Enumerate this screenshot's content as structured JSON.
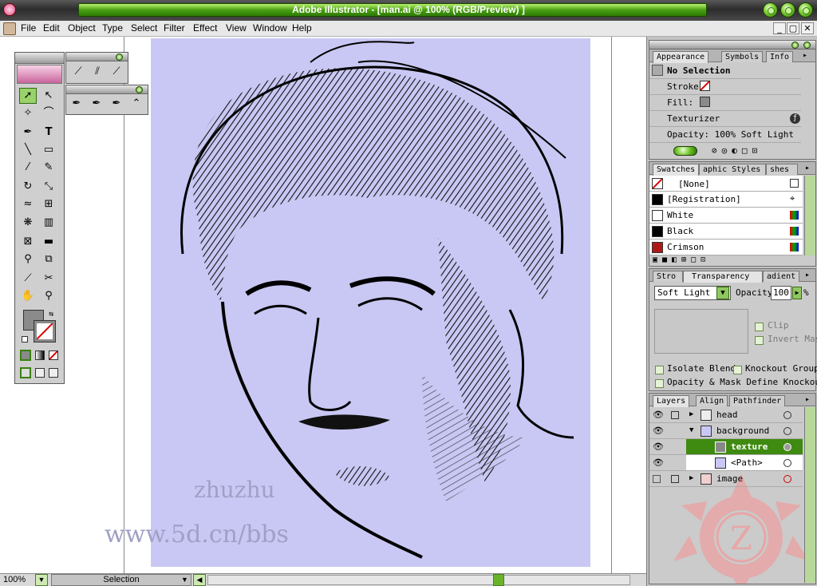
{
  "window": {
    "title": "Adobe Illustrator - [man.ai @ 100% (RGB/Preview) ]"
  },
  "menu": [
    "File",
    "Edit",
    "Object",
    "Type",
    "Select",
    "Filter",
    "Effect",
    "View",
    "Window",
    "Help"
  ],
  "window_controls": {
    "minimize": "_",
    "restore": "▢",
    "close": "✕"
  },
  "canvas": {
    "watermark_name": "zhuzhu",
    "watermark_url": "www.5d.cn/bbs"
  },
  "appearance": {
    "tabs": [
      "Appearance",
      "Symbols",
      "Info"
    ],
    "heading": "No Selection",
    "stroke_label": "Stroke:",
    "fill_label": "Fill:",
    "effect": "Texturizer",
    "opacity": "Opacity: 100% Soft Light"
  },
  "swatches": {
    "tabs": [
      "Swatches",
      "aphic Styles",
      "shes"
    ],
    "items": [
      {
        "name": "[None]",
        "color": "#ffffff"
      },
      {
        "name": "[Registration]",
        "color": "#000000"
      },
      {
        "name": "White",
        "color": "#ffffff"
      },
      {
        "name": "Black",
        "color": "#000000"
      },
      {
        "name": "Crimson",
        "color": "#b01818"
      }
    ]
  },
  "transparency": {
    "tabs": [
      "Stro",
      "Transparency",
      "adient"
    ],
    "blend_mode": "Soft Light",
    "opacity_label": "Opacity",
    "opacity_value": "100",
    "percent": "%",
    "clip": "Clip",
    "invert_mask": "Invert Mas",
    "isolate_blend": "Isolate Blend",
    "knockout_group": "Knockout Group",
    "opacity_mask": "Opacity & Mask Define Knockout"
  },
  "layers": {
    "tabs": [
      "Layers",
      "Align",
      "Pathfinder"
    ],
    "items": [
      {
        "name": "head",
        "selected": false
      },
      {
        "name": "background",
        "selected": false
      },
      {
        "name": "texture",
        "selected": true
      },
      {
        "name": "<Path>",
        "selected": false
      },
      {
        "name": "image",
        "selected": false
      }
    ]
  },
  "status": {
    "zoom": "100%",
    "tool": "Selection"
  },
  "colors": {
    "accent": "#4aa012",
    "artboard": "#c9c8f4",
    "selected_layer": "#3f8a10"
  }
}
